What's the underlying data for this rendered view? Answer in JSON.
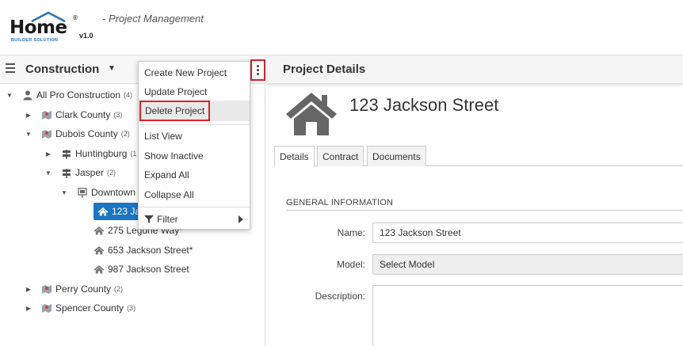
{
  "app": {
    "logo_word": "Home",
    "logo_reg": "®",
    "logo_sub": "BUILDER SOLUTION",
    "version": "v1.0",
    "subtitle": "- Project Management"
  },
  "left_panel": {
    "title": "Construction",
    "title_caret": "▼"
  },
  "tree": [
    {
      "label": "All Pro Construction",
      "count": "(4)",
      "toggle": "▼",
      "icon": "company-icon"
    },
    {
      "label": "Clark County",
      "count": "(3)",
      "toggle": "▶",
      "icon": "county-map-icon"
    },
    {
      "label": "Dubois County",
      "count": "(2)",
      "toggle": "▼",
      "icon": "county-map-icon"
    },
    {
      "label": "Huntingburg",
      "count": "(1",
      "toggle": "▶",
      "icon": "city-sign-icon"
    },
    {
      "label": "Jasper",
      "count": "(2)",
      "toggle": "▼",
      "icon": "city-sign-icon"
    },
    {
      "label": "Downtown",
      "count": "",
      "toggle": "▼",
      "icon": "subdivision-icon"
    },
    {
      "label": "123 Ja",
      "count": "",
      "toggle": "",
      "icon": "house-icon"
    },
    {
      "label": "275 Legune Way*",
      "count": "",
      "toggle": "",
      "icon": "house-icon"
    },
    {
      "label": "653 Jackson Street*",
      "count": "",
      "toggle": "",
      "icon": "house-icon"
    },
    {
      "label": "987 Jackson Street",
      "count": "",
      "toggle": "",
      "icon": "house-icon"
    },
    {
      "label": "Perry County",
      "count": "(2)",
      "toggle": "▶",
      "icon": "county-map-icon"
    },
    {
      "label": "Spencer County",
      "count": "(3)",
      "toggle": "▶",
      "icon": "county-map-icon"
    }
  ],
  "context_menu": {
    "items": [
      {
        "label": "Create New Project"
      },
      {
        "label": "Update Project"
      },
      {
        "label": "Delete Project"
      },
      {
        "label": "List View"
      },
      {
        "label": "Show Inactive"
      },
      {
        "label": "Expand All"
      },
      {
        "label": "Collapse All"
      },
      {
        "label": "Filter"
      }
    ]
  },
  "details": {
    "header_title": "Project Details",
    "project_name": "123 Jackson Street",
    "tabs": [
      {
        "label": "Details",
        "active": true
      },
      {
        "label": "Contract",
        "active": false
      },
      {
        "label": "Documents",
        "active": false
      }
    ],
    "section_title": "GENERAL INFORMATION",
    "fields": {
      "name_label": "Name:",
      "name_value": "123 Jackson Street",
      "model_label": "Model:",
      "model_value": "Select Model",
      "description_label": "Description:"
    }
  },
  "colors": {
    "accent": "#1a75c4",
    "highlight_border": "#d9232e",
    "icon_gray": "#666666"
  }
}
